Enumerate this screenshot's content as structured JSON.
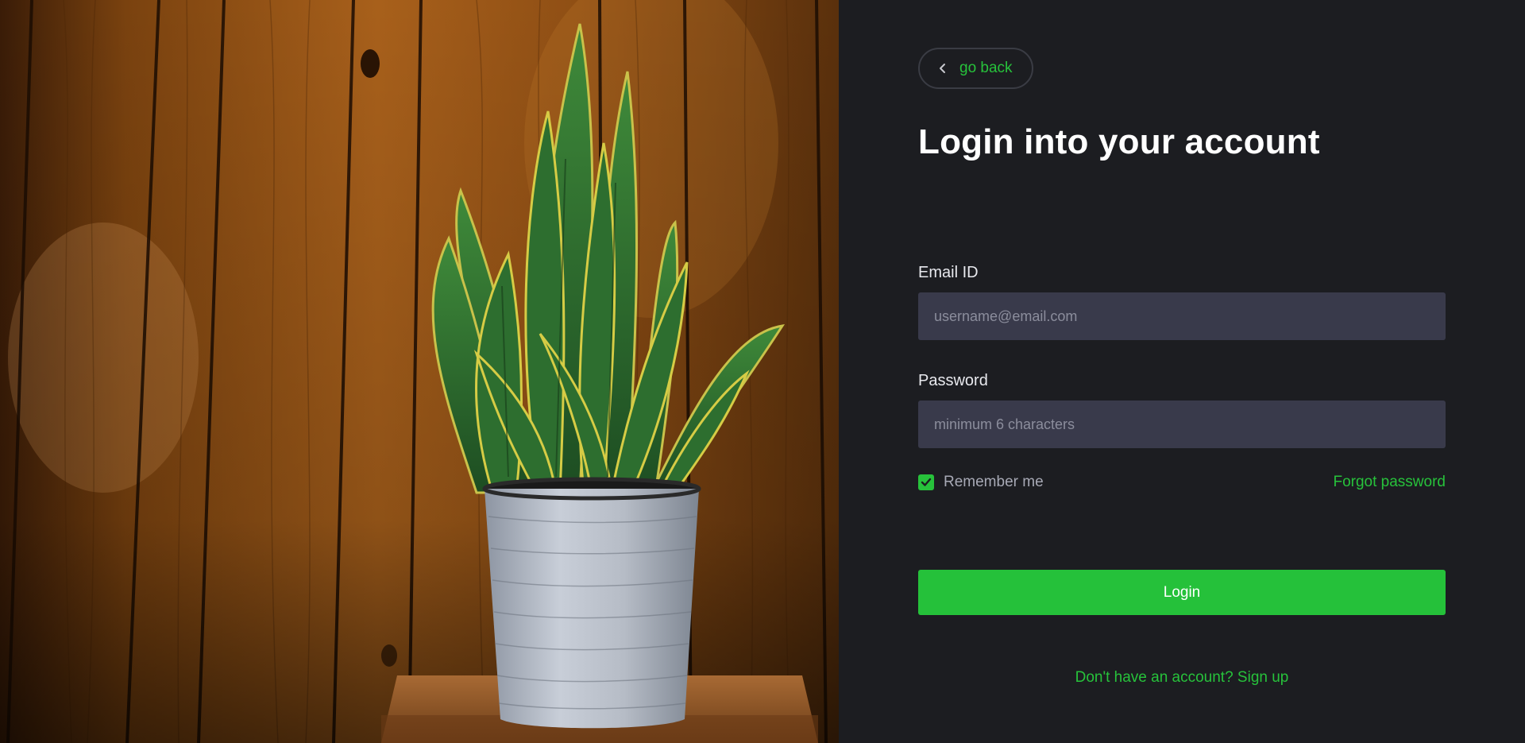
{
  "back_button": {
    "label": "go back",
    "icon": "chevron-left-icon"
  },
  "title": "Login into your account",
  "form": {
    "email": {
      "label": "Email ID",
      "placeholder": "username@email.com",
      "value": ""
    },
    "password": {
      "label": "Password",
      "placeholder": "minimum 6 characters",
      "value": ""
    },
    "remember": {
      "label": "Remember me",
      "checked": true
    },
    "forgot_label": "Forgot password",
    "submit_label": "Login",
    "signup_label": "Don't have an account? Sign up"
  },
  "image": {
    "subject": "snake plant in a grey pot on a wooden stool against wood-panel wall"
  },
  "colors": {
    "accent": "#25c13a",
    "background": "#1c1d21",
    "input_bg": "#393a4b"
  }
}
